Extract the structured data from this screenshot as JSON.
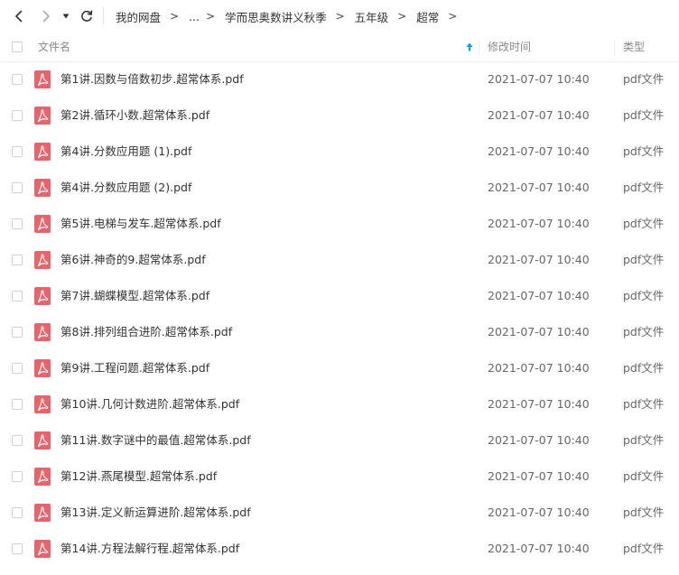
{
  "breadcrumb": {
    "items": [
      "我的网盘",
      "...",
      "学而思奥数讲义秋季",
      "五年级",
      "超常"
    ],
    "separator": ">"
  },
  "columns": {
    "name": "文件名",
    "modified": "修改时间",
    "type": "类型"
  },
  "colors": {
    "accent": "#0a9be8",
    "pdf_icon": "#e8636a",
    "text": "#333333",
    "muted": "#888888"
  },
  "icons": {
    "back": "chevron-left-icon",
    "forward": "chevron-right-icon",
    "history": "caret-down-icon",
    "refresh": "refresh-icon",
    "sort": "sort-ascending-arrow-icon",
    "file": "pdf-file-icon"
  },
  "files": [
    {
      "name": "第1讲.因数与倍数初步.超常体系.pdf",
      "modified": "2021-07-07 10:40",
      "type": "pdf文件"
    },
    {
      "name": "第2讲.循环小数.超常体系.pdf",
      "modified": "2021-07-07 10:40",
      "type": "pdf文件"
    },
    {
      "name": "第4讲.分数应用题 (1).pdf",
      "modified": "2021-07-07 10:40",
      "type": "pdf文件"
    },
    {
      "name": "第4讲.分数应用题 (2).pdf",
      "modified": "2021-07-07 10:40",
      "type": "pdf文件"
    },
    {
      "name": "第5讲.电梯与发车.超常体系.pdf",
      "modified": "2021-07-07 10:40",
      "type": "pdf文件"
    },
    {
      "name": "第6讲.神奇的9.超常体系.pdf",
      "modified": "2021-07-07 10:40",
      "type": "pdf文件"
    },
    {
      "name": "第7讲.蝴蝶模型.超常体系.pdf",
      "modified": "2021-07-07 10:40",
      "type": "pdf文件"
    },
    {
      "name": "第8讲.排列组合进阶.超常体系.pdf",
      "modified": "2021-07-07 10:40",
      "type": "pdf文件"
    },
    {
      "name": "第9讲.工程问题.超常体系.pdf",
      "modified": "2021-07-07 10:40",
      "type": "pdf文件"
    },
    {
      "name": "第10讲.几何计数进阶.超常体系.pdf",
      "modified": "2021-07-07 10:40",
      "type": "pdf文件"
    },
    {
      "name": "第11讲.数字谜中的最值.超常体系.pdf",
      "modified": "2021-07-07 10:40",
      "type": "pdf文件"
    },
    {
      "name": "第12讲.燕尾模型.超常体系.pdf",
      "modified": "2021-07-07 10:40",
      "type": "pdf文件"
    },
    {
      "name": "第13讲.定义新运算进阶.超常体系.pdf",
      "modified": "2021-07-07 10:40",
      "type": "pdf文件"
    },
    {
      "name": "第14讲.方程法解行程.超常体系.pdf",
      "modified": "2021-07-07 10:40",
      "type": "pdf文件"
    }
  ]
}
